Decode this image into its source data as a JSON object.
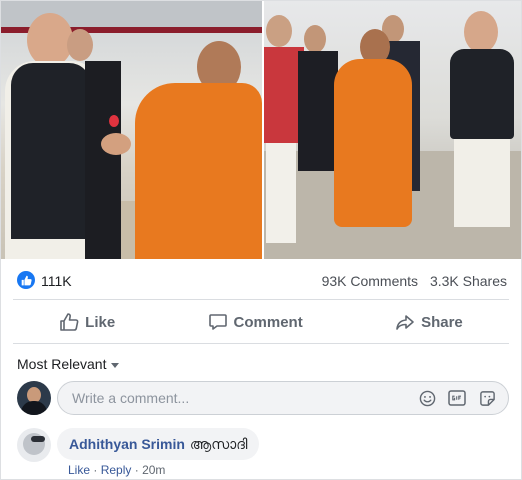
{
  "post": {
    "reactions": {
      "count": "111K",
      "icon": "thumbs-up-icon",
      "color": "#1877f2"
    },
    "comments_count": "93K Comments",
    "shares_count": "3.3K Shares"
  },
  "actions": {
    "like_label": "Like",
    "comment_label": "Comment",
    "share_label": "Share"
  },
  "comments": {
    "sort_label": "Most Relevant",
    "input_placeholder": "Write a comment...",
    "input_icons": [
      "emoji-icon",
      "gif-icon",
      "sticker-icon"
    ],
    "items": [
      {
        "author": "Adhithyan Srimin",
        "text": "ആസാദി",
        "actions": [
          "Like",
          "Reply"
        ],
        "time": "20m"
      }
    ]
  },
  "colors": {
    "accent": "#1877f2",
    "link": "#385898",
    "saffron": "#e8791f"
  }
}
